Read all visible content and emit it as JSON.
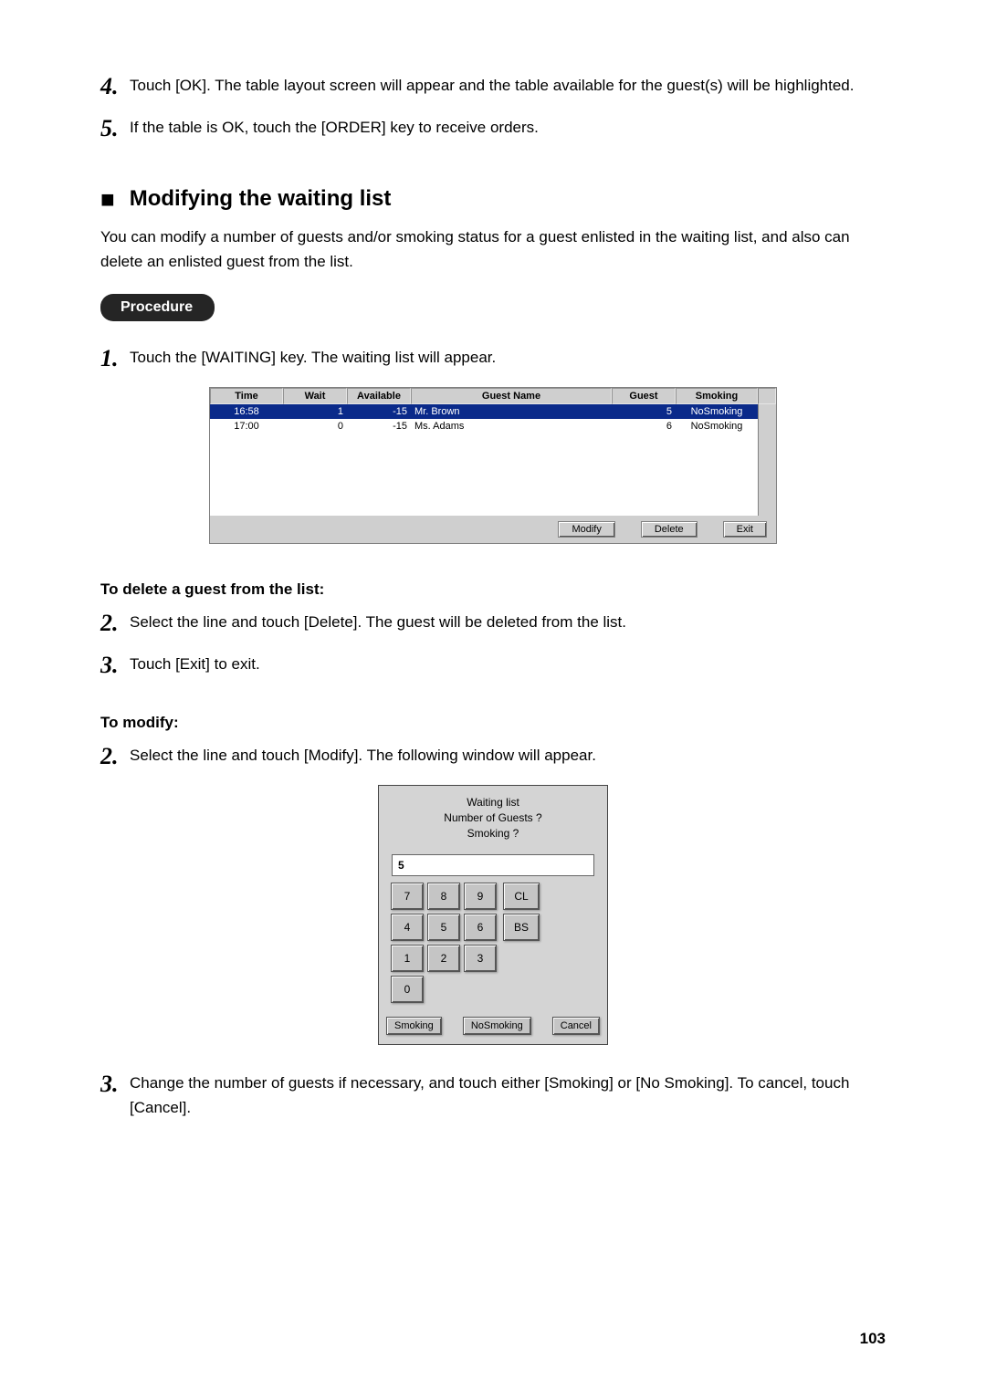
{
  "steps_top": [
    {
      "n": "4",
      "text": "Touch [OK].  The table layout screen will appear and the table available for the guest(s) will be highlighted."
    },
    {
      "n": "5",
      "text": "If the table is OK, touch the [ORDER] key to receive orders."
    }
  ],
  "section_heading": "Modifying the waiting list",
  "section_intro": "You can modify a number of guests and/or smoking status for a guest enlisted in the waiting list, and also can delete an enlisted guest from the list.",
  "procedure_label": "Procedure",
  "step_proc_1": {
    "n": "1",
    "text": "Touch the [WAITING] key.  The waiting list will appear."
  },
  "waiting_list": {
    "headers": [
      "Time",
      "Wait",
      "Available",
      "Guest Name",
      "Guest",
      "Smoking"
    ],
    "rows": [
      {
        "time": "16:58",
        "wait": "1",
        "available": "-15",
        "name": "Mr. Brown",
        "guest": "5",
        "smoking": "NoSmoking",
        "selected": true
      },
      {
        "time": "17:00",
        "wait": "0",
        "available": "-15",
        "name": "Ms. Adams",
        "guest": "6",
        "smoking": "NoSmoking",
        "selected": false
      }
    ],
    "buttons": {
      "modify": "Modify",
      "del": "Delete",
      "exit": "Exit"
    }
  },
  "delete_heading": "To delete a guest from the list:",
  "delete_steps": [
    {
      "n": "2",
      "text": "Select the line and touch [Delete].  The guest will be deleted from the list."
    },
    {
      "n": "3",
      "text": "Touch [Exit] to exit."
    }
  ],
  "modify_heading": "To modify:",
  "modify_step_2": {
    "n": "2",
    "text": "Select the line and touch [Modify].  The following window will appear."
  },
  "dialog": {
    "title_lines": [
      "Waiting list",
      "Number of Guests ?",
      "Smoking ?"
    ],
    "entry_value": "5",
    "keys": {
      "r1": [
        "7",
        "8",
        "9",
        "CL"
      ],
      "r2": [
        "4",
        "5",
        "6",
        "BS"
      ],
      "r3": [
        "1",
        "2",
        "3"
      ],
      "r4": [
        "0"
      ]
    },
    "buttons": {
      "smoking": "Smoking",
      "nosmoking": "NoSmoking",
      "cancel": "Cancel"
    }
  },
  "modify_step_3": {
    "n": "3",
    "text": "Change the number of guests if necessary, and touch either [Smoking] or [No Smoking]. To cancel, touch [Cancel]."
  },
  "page_number": "103"
}
